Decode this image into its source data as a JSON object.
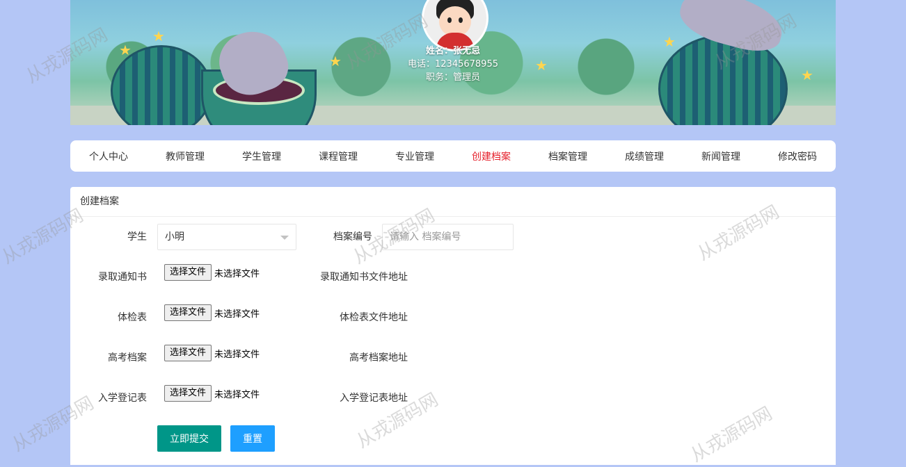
{
  "profile": {
    "name": "姓名：张无忌",
    "phone": "电话：12345678955",
    "role": "职务：管理员"
  },
  "nav": {
    "items": [
      {
        "label": "个人中心",
        "active": false
      },
      {
        "label": "教师管理",
        "active": false
      },
      {
        "label": "学生管理",
        "active": false
      },
      {
        "label": "课程管理",
        "active": false
      },
      {
        "label": "专业管理",
        "active": false
      },
      {
        "label": "创建档案",
        "active": true
      },
      {
        "label": "档案管理",
        "active": false
      },
      {
        "label": "成绩管理",
        "active": false
      },
      {
        "label": "新闻管理",
        "active": false
      },
      {
        "label": "修改密码",
        "active": false
      }
    ],
    "active_color": "#e5202b"
  },
  "form": {
    "header": "创建档案",
    "student_label": "学生",
    "student_value": "小明",
    "archive_no_label": "档案编号",
    "archive_no_placeholder": "请输入 档案编号",
    "file_button_label": "选择文件",
    "file_status": "未选择文件",
    "fields": [
      {
        "label": "录取通知书",
        "address_label": "录取通知书文件地址"
      },
      {
        "label": "体检表",
        "address_label": "体检表文件地址"
      },
      {
        "label": "高考档案",
        "address_label": "高考档案地址"
      },
      {
        "label": "入学登记表",
        "address_label": "入学登记表地址"
      }
    ],
    "submit_label": "立即提交",
    "reset_label": "重置"
  },
  "watermark": "从戎源码网",
  "colors": {
    "page_background": "#b4c6f6",
    "submit_button": "#009688",
    "reset_button": "#1e9fff"
  }
}
